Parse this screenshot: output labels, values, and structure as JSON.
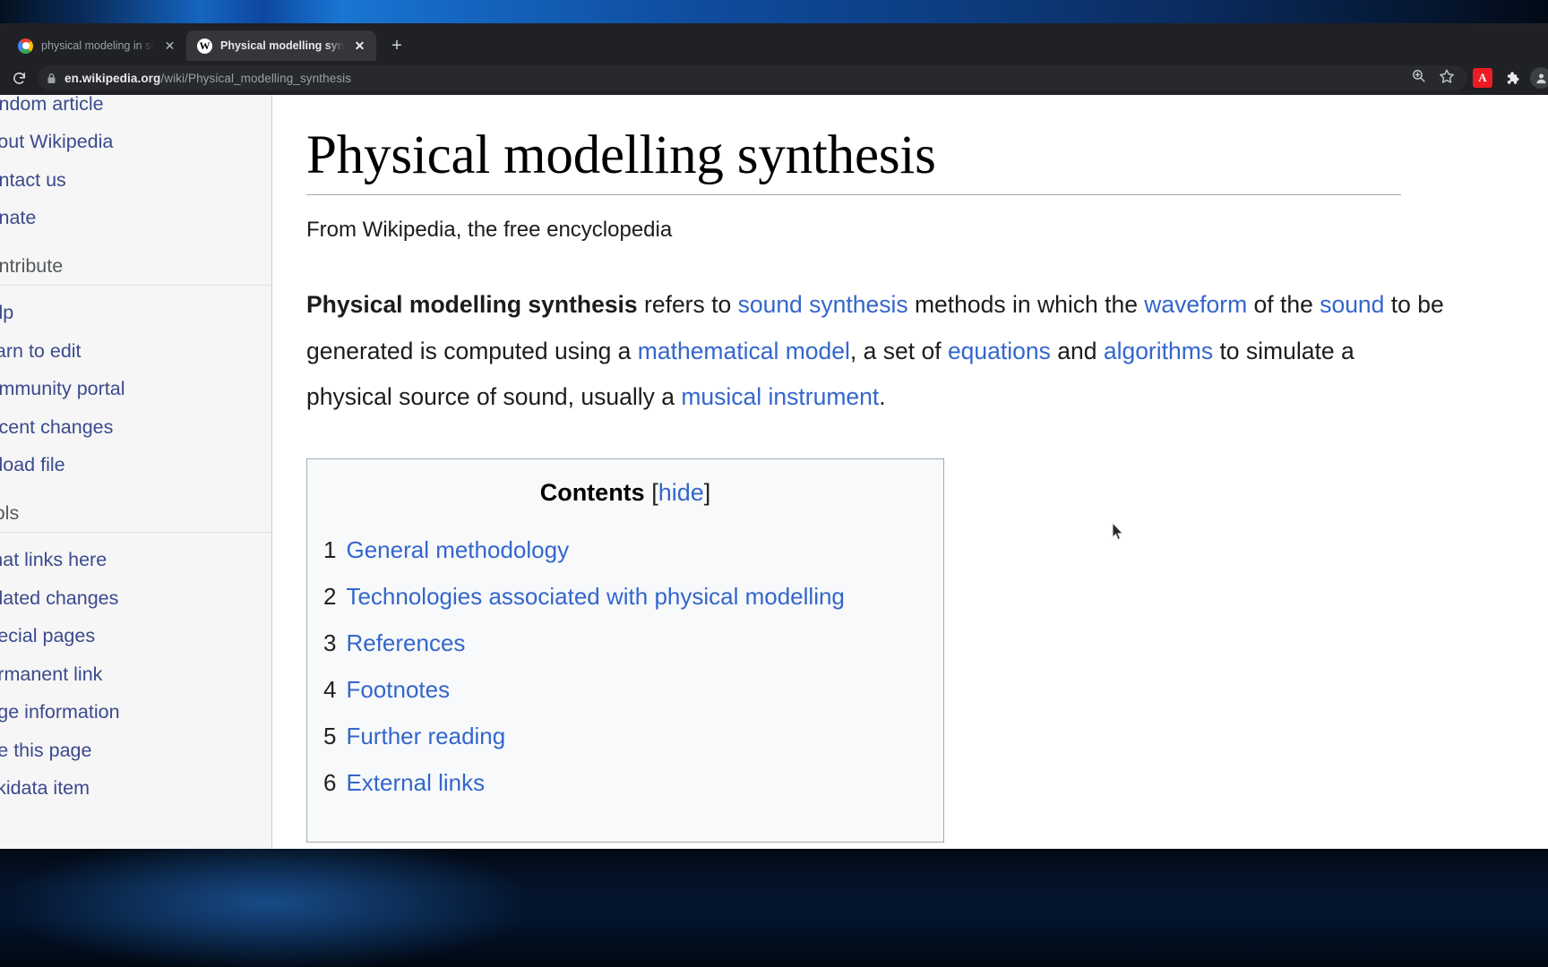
{
  "browser": {
    "tabs": [
      {
        "title": "physical modeling in serum - G",
        "favicon": "google-icon",
        "active": false
      },
      {
        "title": "Physical modelling synthesis -",
        "favicon": "wikipedia-icon",
        "active": true,
        "favicon_glyph": "W"
      }
    ],
    "new_tab_label": "+",
    "reload_label": "⟳",
    "omnibox": {
      "url_host": "en.wikipedia.org",
      "url_path": "/wiki/Physical_modelling_synthesis",
      "lock_icon": "lock-icon"
    },
    "actions": {
      "zoom_icon": "zoom-in-icon",
      "bookmark_icon": "star-icon",
      "pdf_extension_label": "A",
      "extensions_icon": "puzzle-piece-icon",
      "profile_icon": "avatar-icon"
    }
  },
  "sidebar": {
    "top_items": [
      "Random article",
      "About Wikipedia",
      "Contact us",
      "Donate"
    ],
    "contribute_heading": "Contribute",
    "contribute_items": [
      "Help",
      "Learn to edit",
      "Community portal",
      "Recent changes",
      "Upload file"
    ],
    "tools_heading": "Tools",
    "tools_items": [
      "What links here",
      "Related changes",
      "Special pages",
      "Permanent link",
      "Page information",
      "Cite this page",
      "Wikidata item"
    ]
  },
  "article": {
    "title": "Physical modelling synthesis",
    "tagline": "From Wikipedia, the free encyclopedia",
    "lead": {
      "bold_term": "Physical modelling synthesis",
      "t1": " refers to ",
      "l1": "sound synthesis",
      "t2": " methods in which the ",
      "l2": "waveform",
      "t3": " of the ",
      "l3": "sound",
      "t4": " to be generated is computed using a ",
      "l4": "mathematical model",
      "t5": ", a set of ",
      "l5": "equations",
      "t6": " and ",
      "l6": "algorithms",
      "t7": " to simulate a physical source of sound, usually a ",
      "l7": "musical instrument",
      "t8": "."
    },
    "toc": {
      "heading": "Contents",
      "bracket_open": "[",
      "hide_label": "hide",
      "bracket_close": "]",
      "items": [
        {
          "num": "1",
          "label": "General methodology"
        },
        {
          "num": "2",
          "label": "Technologies associated with physical modelling"
        },
        {
          "num": "3",
          "label": "References"
        },
        {
          "num": "4",
          "label": "Footnotes"
        },
        {
          "num": "5",
          "label": "Further reading"
        },
        {
          "num": "6",
          "label": "External links"
        }
      ]
    }
  },
  "colors": {
    "link": "#3366cc",
    "sidebar_link": "#3a4a8c",
    "chrome_bg": "#202124",
    "active_tab": "#35363a"
  }
}
